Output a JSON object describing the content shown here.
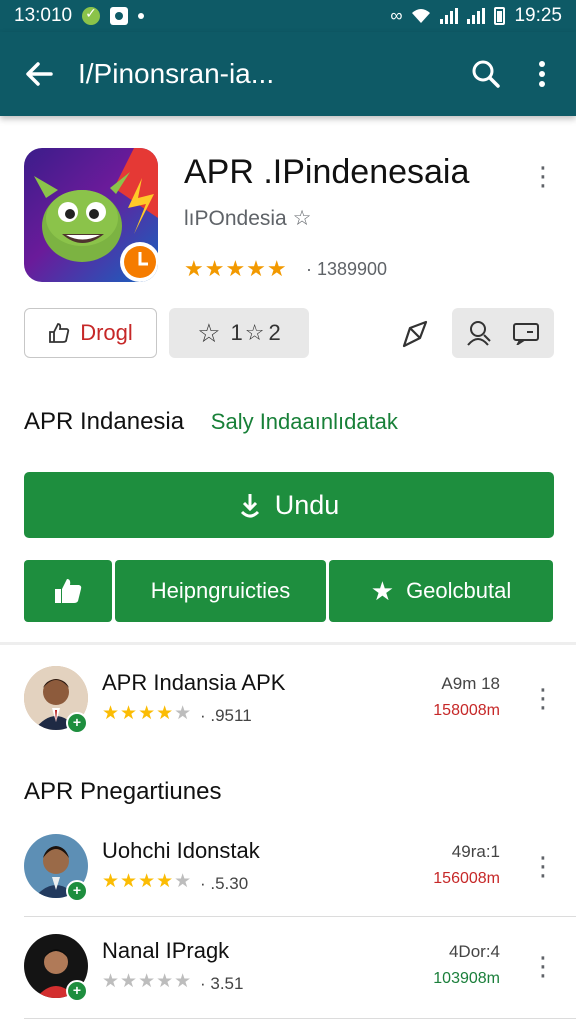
{
  "status_bar": {
    "time_left": "13:010",
    "time_right": "19:25"
  },
  "app_bar": {
    "title": "I/Pinonsran-ia...",
    "icons": [
      "back-arrow-icon",
      "search-icon",
      "overflow-menu-icon"
    ]
  },
  "app": {
    "name": "APR .IPindenesaia",
    "developer": "lıPOndesia",
    "stars": "★★★★★",
    "review_count": "· 1389900"
  },
  "chips": {
    "outline_label": "Drogl",
    "rating_label": "1",
    "rating_value": "2"
  },
  "section": {
    "label": "APR Indanesia",
    "green_text": "Saly Indaaınlıdatak"
  },
  "install_label": "Undu",
  "buttons": {
    "middle_label": "Heipngruicties",
    "right_label": "Geolcbutal"
  },
  "subheading": "APR Pnegartiunes",
  "list": [
    {
      "title": "APR Indansia APK",
      "stars_on": "★★★★",
      "stars_off": "★",
      "rating": "· .9511",
      "meta": "A9m 18",
      "size": "158008m",
      "size_color": "#c62828"
    },
    {
      "title": "Uohchi Idonstak",
      "stars_on": "★★★★",
      "stars_off": "★",
      "rating": "· .5.30",
      "meta": "49ra:1",
      "size": "156008m",
      "size_color": "#c62828"
    },
    {
      "title": "Nanal IPragk",
      "stars_on": "",
      "stars_off": "★★★★★",
      "rating": "· 3.51",
      "meta": "4Dor:4",
      "size": "103908m",
      "size_color": "#1b7f3b"
    }
  ],
  "colors": {
    "app_bar": "#0e5a66",
    "primary_green": "#1e8e3e",
    "star_orange": "#f29900",
    "star_yellow": "#fbbc04"
  }
}
